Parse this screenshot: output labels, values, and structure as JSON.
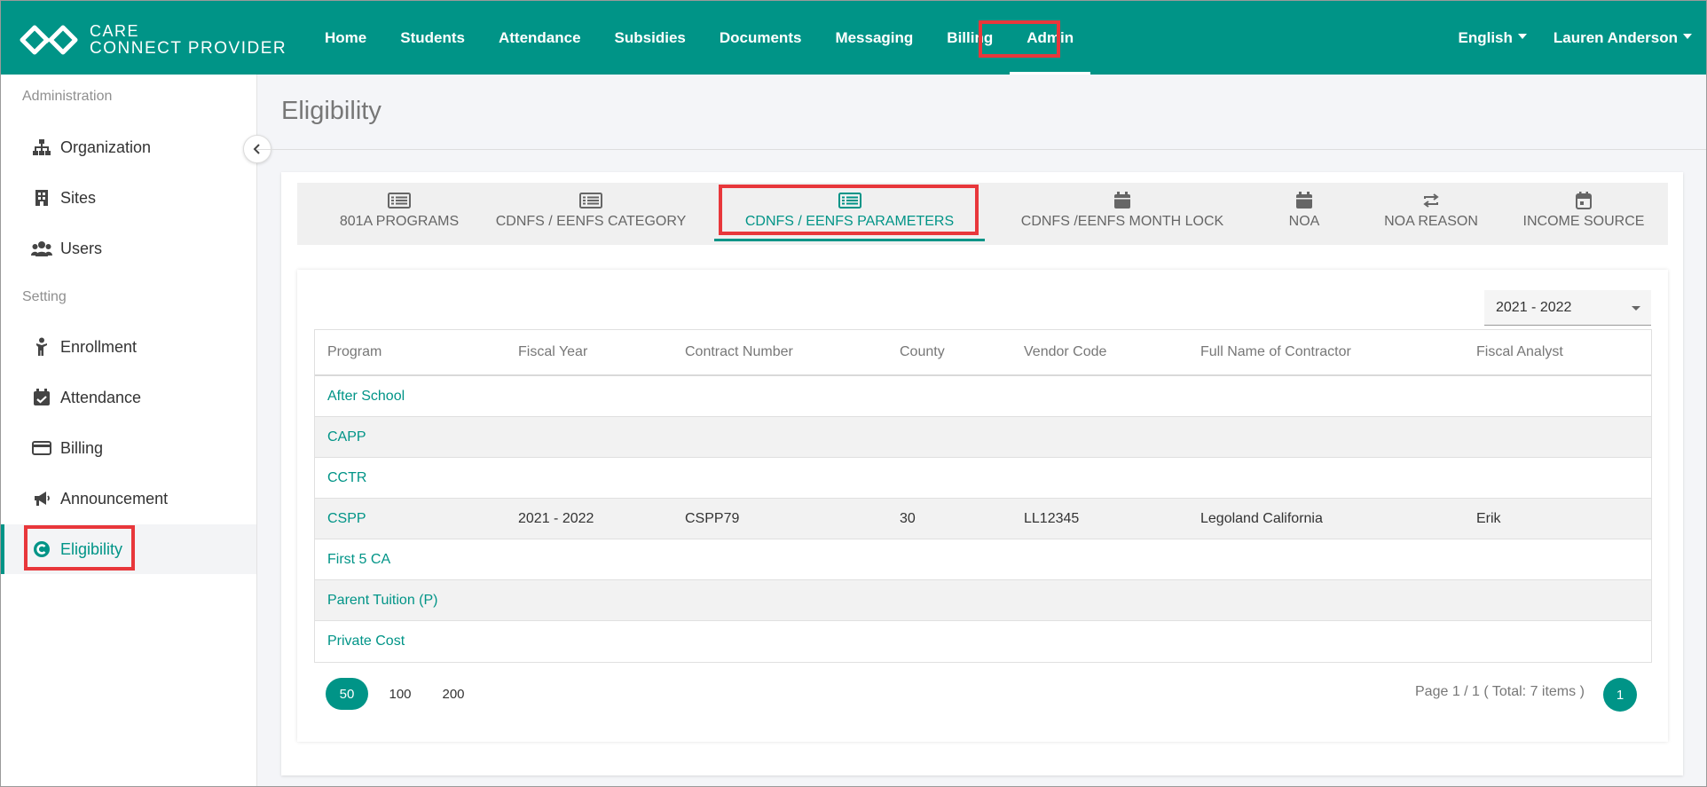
{
  "app": {
    "logo_line1": "CARE",
    "logo_line2": "CONNECT PROVIDER",
    "accent_color": "#009487",
    "highlight_color": "#e8373b"
  },
  "nav": {
    "items": [
      {
        "label": "Home"
      },
      {
        "label": "Students"
      },
      {
        "label": "Attendance"
      },
      {
        "label": "Subsidies"
      },
      {
        "label": "Documents"
      },
      {
        "label": "Messaging"
      },
      {
        "label": "Billing"
      },
      {
        "label": "Admin",
        "active": true
      }
    ],
    "language": "English",
    "user": "Lauren Anderson"
  },
  "sidebar": {
    "admin_heading": "Administration",
    "setting_heading": "Setting",
    "admin_items": [
      {
        "label": "Organization",
        "icon": "sitemap-icon"
      },
      {
        "label": "Sites",
        "icon": "building-icon"
      },
      {
        "label": "Users",
        "icon": "users-icon"
      }
    ],
    "setting_items": [
      {
        "label": "Enrollment",
        "icon": "child-icon"
      },
      {
        "label": "Attendance",
        "icon": "calendar-check-icon"
      },
      {
        "label": "Billing",
        "icon": "credit-card-icon"
      },
      {
        "label": "Announcement",
        "icon": "megaphone-icon"
      },
      {
        "label": "Eligibility",
        "icon": "eligibility-icon",
        "active": true
      }
    ]
  },
  "page": {
    "title": "Eligibility"
  },
  "tabs": [
    {
      "label": "801A PROGRAMS",
      "icon": "list-icon"
    },
    {
      "label": "CDNFS / EENFS CATEGORY",
      "icon": "list-icon"
    },
    {
      "label": "CDNFS / EENFS PARAMETERS",
      "icon": "list-icon",
      "active": true
    },
    {
      "label": "CDNFS /EENFS MONTH LOCK",
      "icon": "calendar-icon"
    },
    {
      "label": "NOA",
      "icon": "calendar-icon"
    },
    {
      "label": "NOA REASON",
      "icon": "repeat-icon"
    },
    {
      "label": "INCOME SOURCE",
      "icon": "calendar-day-icon"
    }
  ],
  "filter": {
    "fiscal_year": "2021 - 2022"
  },
  "table": {
    "columns": [
      "Program",
      "Fiscal Year",
      "Contract Number",
      "County",
      "Vendor Code",
      "Full Name of Contractor",
      "Fiscal Analyst"
    ],
    "rows": [
      [
        "After School",
        "",
        "",
        "",
        "",
        "",
        ""
      ],
      [
        "CAPP",
        "",
        "",
        "",
        "",
        "",
        ""
      ],
      [
        "CCTR",
        "",
        "",
        "",
        "",
        "",
        ""
      ],
      [
        "CSPP",
        "2021 - 2022",
        "CSPP79",
        "30",
        "LL12345",
        "Legoland California",
        "Erik"
      ],
      [
        "First 5 CA",
        "",
        "",
        "",
        "",
        "",
        ""
      ],
      [
        "Parent Tuition (P)",
        "",
        "",
        "",
        "",
        "",
        ""
      ],
      [
        "Private Cost",
        "",
        "",
        "",
        "",
        "",
        ""
      ]
    ]
  },
  "pagination": {
    "page_sizes": [
      "50",
      "100",
      "200"
    ],
    "selected_size": "50",
    "info": "Page 1 / 1 ( Total: 7 items )",
    "current_page": "1"
  }
}
